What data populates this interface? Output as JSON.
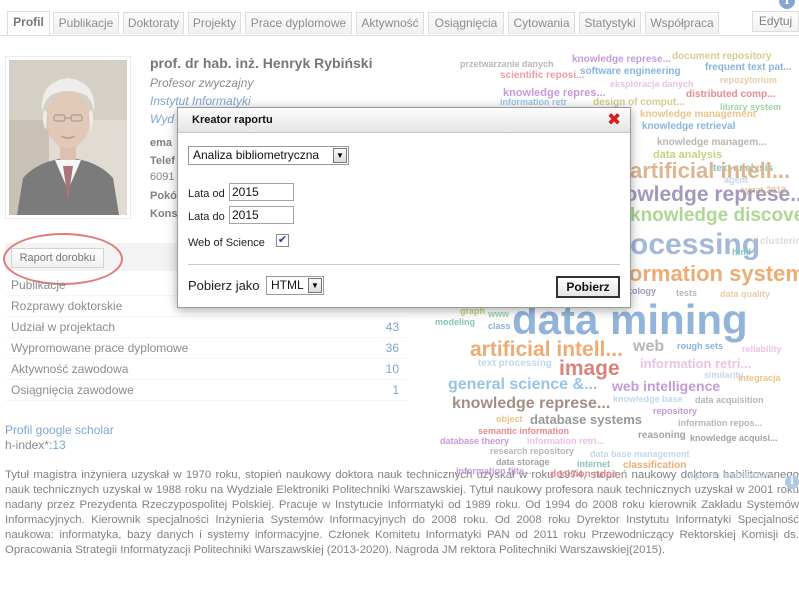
{
  "tabs": [
    {
      "label": "Profil",
      "active": true
    },
    {
      "label": "Publikacje"
    },
    {
      "label": "Doktoraty"
    },
    {
      "label": "Projekty"
    },
    {
      "label": "Prace dyplomowe"
    },
    {
      "label": "Aktywność"
    },
    {
      "label": "Osiągnięcia"
    },
    {
      "label": "Cytowania"
    },
    {
      "label": "Statystyki"
    },
    {
      "label": "Współpraca"
    }
  ],
  "edit_label": "Edytuj",
  "info_glyph": "i",
  "profile": {
    "name": "prof. dr hab. inż. Henryk Rybiński",
    "position": "Profesor zwyczajny",
    "institute": "Instytut Informatyki",
    "faculty_partial": "Wyd",
    "email_partial": "ema",
    "phone_label_partial": "Telef",
    "phone_partial": "6091",
    "room_partial": "Pokó",
    "consult_partial": "Kons"
  },
  "report_button": "Raport dorobku",
  "stats": [
    {
      "label": "Publikacje",
      "value": ""
    },
    {
      "label": "Rozprawy doktorskie",
      "value": ""
    },
    {
      "label": "Udział w projektach",
      "value": "43"
    },
    {
      "label": "Wypromowane prace dyplomowe",
      "value": "36"
    },
    {
      "label": "Aktywność zawodowa",
      "value": "10"
    },
    {
      "label": "Osiągnięcia zawodowe",
      "value": "1"
    }
  ],
  "google_scholar": "Profil google scholar",
  "hindex_label": "h-index*:",
  "hindex_value": "13",
  "bio": "Tytuł magistra inżyniera uzyskał w 1970 roku, stopień naukowy doktora nauk technicznych uzyskał w roku 1974, stopień naukowy doktora habilitowanego nauk technicznych uzyskał w 1988 roku na Wydziale Elektroniki Politechniki Warszawskiej. Tytuł naukowy profesora nauk technicznych uzyskał w 2001 roku nadany przez Prezydenta Rzeczypospolitej Polskiej. Pracuje w Instytucie Informatyki od 1989 roku. Od 1994 do 2008 roku kierownik Zakładu Systemów Informacyjnych. Kierownik specjalności Inżynieria Systemów Informacyjnych do 2008 roku. Od 2008 roku Dyrektor Instytutu Informatyki Specjalność naukowa: informatyka, bazy danych i systemy informacyjne. Członek Komitetu Informatyki PAN od 2011 roku Przewodniczący Rektorskiej Komisji ds. Opracowania Strategii Informatyzacji Politechniki Warszawskiej (2013-2020). Nagroda JM rektora Politechniki Warszawskiej(2015).",
  "tag_cloud": [
    {
      "text": "przetwarzanie danych",
      "color": "#8c8c8c"
    },
    {
      "text": "knowledge represe...",
      "color": "#a45dc2"
    },
    {
      "text": "document repository",
      "color": "#b8b048"
    },
    {
      "text": "scientific reposi...",
      "color": "#e0606a"
    },
    {
      "text": "software engineering",
      "color": "#3f86c8"
    },
    {
      "text": "frequent text pat...",
      "color": "#3f86c8"
    },
    {
      "text": "eksploracja danych",
      "color": "#e29ad8"
    },
    {
      "text": "repozytorium",
      "color": "#d8b070"
    },
    {
      "text": "knowledge repres...",
      "color": "#a45dc2"
    },
    {
      "text": "design of comput...",
      "color": "#b8b048"
    },
    {
      "text": "distributed comp...",
      "color": "#d8434a"
    },
    {
      "text": "information retr",
      "color": "#5a9fd4"
    },
    {
      "text": "knowledge management",
      "color": "#e0a040"
    },
    {
      "text": "library system",
      "color": "#5cbe6e"
    },
    {
      "text": "knowledge retrieval",
      "color": "#3f86c8"
    },
    {
      "text": "knowledge managem...",
      "color": "#8a8a8a"
    },
    {
      "text": "data analysis",
      "color": "#a0b830"
    },
    {
      "text": "text analysis",
      "color": "#3aa088"
    },
    {
      "text": "artificial intell...",
      "color": "#c98a4b"
    },
    {
      "text": "agent",
      "color": "#9cc0de"
    },
    {
      "text": "synat 2013",
      "color": "#e0a040"
    },
    {
      "text": "knowledge represe...",
      "color": "#6b5b95"
    },
    {
      "text": "knowledge discovery",
      "color": "#7cbf52"
    },
    {
      "text": "clustering",
      "color": "#c0c8d0"
    },
    {
      "text": "processing",
      "color": "#6a8fc2"
    },
    {
      "text": "html",
      "color": "#3aa088"
    },
    {
      "text": "information systems",
      "color": "#e07a20"
    },
    {
      "text": "ontology",
      "color": "#6b5b95"
    },
    {
      "text": "tests",
      "color": "#8a8a8a"
    },
    {
      "text": "data quality",
      "color": "#d8b070"
    },
    {
      "text": "graph",
      "color": "#a0b830"
    },
    {
      "text": "www",
      "color": "#5cbe6e"
    },
    {
      "text": "data mining",
      "color": "#4f86c6"
    },
    {
      "text": "modeling",
      "color": "#3aa088"
    },
    {
      "text": "class",
      "color": "#3f86c8"
    },
    {
      "text": "artificial intell...",
      "color": "#e07a20"
    },
    {
      "text": "web",
      "color": "#8a8a8a"
    },
    {
      "text": "rough sets",
      "color": "#3f86c8"
    },
    {
      "text": "reliability",
      "color": "#e29ad8"
    },
    {
      "text": "text processing",
      "color": "#9cc0de"
    },
    {
      "text": "image",
      "color": "#c0392b"
    },
    {
      "text": "information retri...",
      "color": "#e29ad8"
    },
    {
      "text": "similarity",
      "color": "#9cc0de"
    },
    {
      "text": "integracja",
      "color": "#e0a040"
    },
    {
      "text": "general science &...",
      "color": "#5a9fd4"
    },
    {
      "text": "web intelligence",
      "color": "#a45dc2"
    },
    {
      "text": "knowledge base",
      "color": "#9cc0de"
    },
    {
      "text": "data acquisition",
      "color": "#8a8a8a"
    },
    {
      "text": "knowledge represe...",
      "color": "#6b4a35"
    },
    {
      "text": "repository",
      "color": "#a45dc2"
    },
    {
      "text": "object",
      "color": "#e0a040"
    },
    {
      "text": "database systems",
      "color": "#5a5a5a"
    },
    {
      "text": "information repos...",
      "color": "#8a8a8a"
    },
    {
      "text": "semantic information",
      "color": "#d8434a"
    },
    {
      "text": "reasoning",
      "color": "#6a6a6a"
    },
    {
      "text": "knowledge acquisi...",
      "color": "#6a6a6a"
    },
    {
      "text": "database theory",
      "color": "#a45dc2"
    },
    {
      "text": "information retri...",
      "color": "#e29ad8"
    },
    {
      "text": "research repository",
      "color": "#8a8a8a"
    },
    {
      "text": "data base management",
      "color": "#9cc0de"
    },
    {
      "text": "data storage",
      "color": "#6a6a6a"
    },
    {
      "text": "internet",
      "color": "#3aa088"
    },
    {
      "text": "classification",
      "color": "#e07a20"
    },
    {
      "text": "information filte...",
      "color": "#a45dc2"
    },
    {
      "text": "decision rules",
      "color": "#d8434a"
    },
    {
      "text": "system architecture",
      "color": "#9cc0de"
    }
  ],
  "modal": {
    "title": "Kreator raportu",
    "close_glyph": "✖",
    "report_type": "Analiza bibliometryczna",
    "year_from_label": "Lata od",
    "year_from": "2015",
    "year_to_label": "Lata do",
    "year_to": "2015",
    "wos_label": "Web of Science",
    "wos_checked": true,
    "format_label": "Pobierz jako",
    "format": "HTML",
    "download_label": "Pobierz"
  }
}
